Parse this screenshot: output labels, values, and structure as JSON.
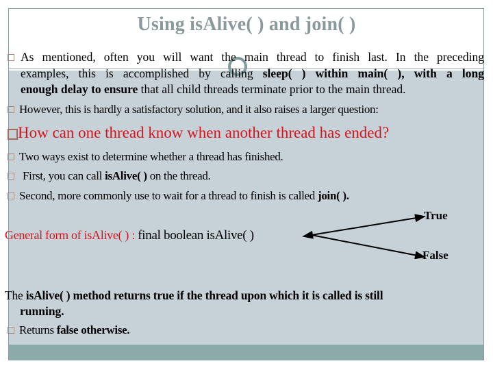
{
  "title": "Using isAlive( ) and join( )",
  "colors": {
    "title": "#8a9a9c",
    "accent_red": "#d8141c",
    "content_background": "#c6d1d8",
    "footer_band": "#8aaba9"
  },
  "bullets": {
    "b1": {
      "line1": "As mentioned, often you will want the main thread to finish last. In the preceding",
      "line2_plain": "examples, this is accomplished by calling ",
      "line2_bold": "sleep( ) within main( ), with a long",
      "line3_bold": "enough delay to ensure",
      "line3_plain": " that all child threads terminate prior to the main thread."
    },
    "b2": "However, this is hardly a satisfactory solution, and it also raises a larger question:",
    "question": "How can one thread know when another thread has ended?",
    "b3": "Two ways exist to determine whether a thread has finished.",
    "b4": {
      "plain_before": "First, you can call ",
      "bold": "isAlive( )",
      "plain_after": " on the thread."
    },
    "b5": {
      "plain": "Second, more commonly use to wait for a thread to finish is called ",
      "bold": "join( )."
    }
  },
  "general_form": {
    "label": "General form  of isAlive( ) : ",
    "signature": "final boolean isAlive( )",
    "outcome_true": "True",
    "outcome_false": "False"
  },
  "explanation": {
    "plain": "The ",
    "bold_line1": "isAlive( ) method returns true if the thread upon which it is called is still",
    "bold_line2": "running.",
    "b6_plain": "Returns ",
    "b6_bold": "false otherwise."
  }
}
